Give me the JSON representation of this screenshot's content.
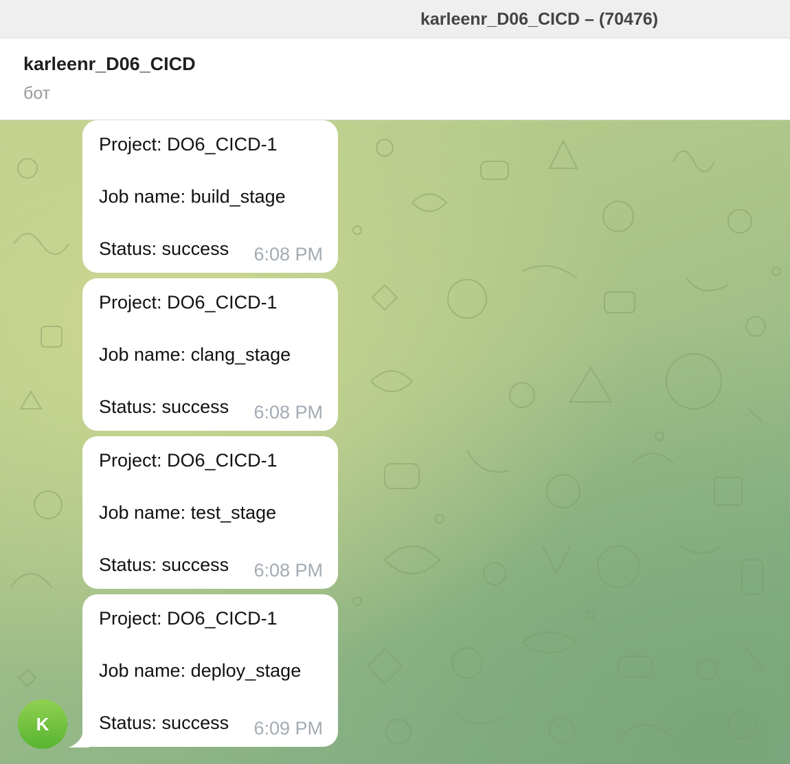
{
  "window": {
    "title": "karleenr_D06_CICD – (70476)"
  },
  "chat": {
    "name": "karleenr_D06_CICD",
    "status": "бот",
    "avatar_letter": "K",
    "avatar_color": "#6cc13d",
    "background_color": "#a9c488"
  },
  "messages": [
    {
      "project": "Project: DO6_CICD-1",
      "job": "Job name: build_stage",
      "status": "Status: success",
      "time": "6:08 PM"
    },
    {
      "project": "Project: DO6_CICD-1",
      "job": "Job name: clang_stage",
      "status": "Status: success",
      "time": "6:08 PM"
    },
    {
      "project": "Project: DO6_CICD-1",
      "job": "Job name: test_stage",
      "status": "Status: success",
      "time": "6:08 PM"
    },
    {
      "project": "Project: DO6_CICD-1",
      "job": "Job name: deploy_stage",
      "status": "Status: success",
      "time": "6:09 PM"
    }
  ]
}
